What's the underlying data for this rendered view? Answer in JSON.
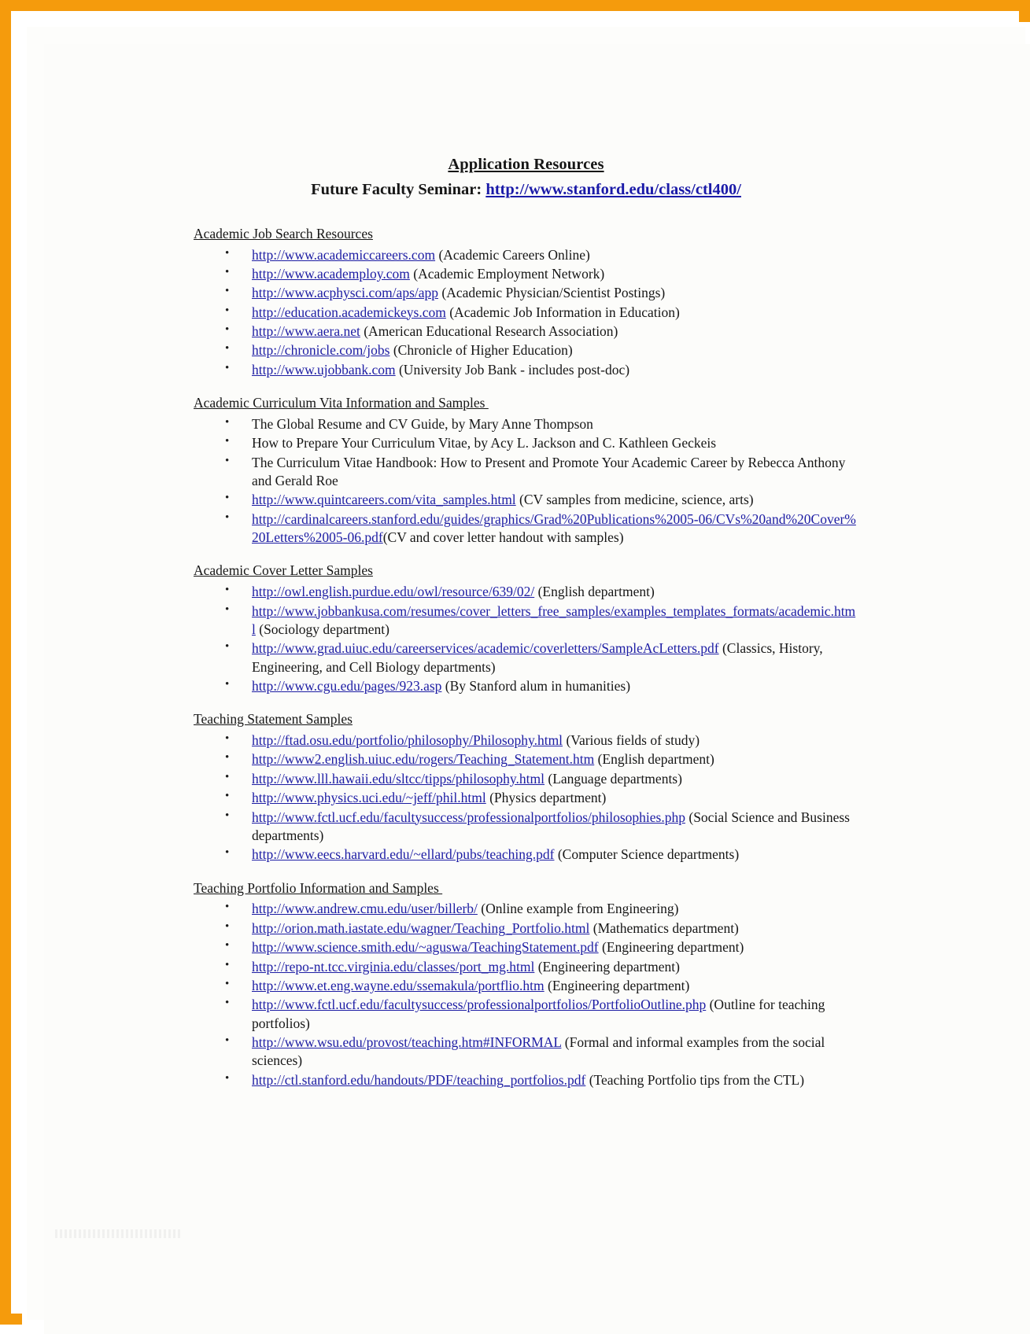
{
  "page": {
    "border_color": "#F59B0C",
    "link_color": "#1d1da4",
    "text_color": "#161616"
  },
  "header": {
    "title": "Application Resources",
    "subtitle_label": "Future Faculty Seminar:",
    "subtitle_url": "http://www.stanford.edu/class/ctl400/"
  },
  "sections": [
    {
      "heading": "Academic Job Search Resources",
      "items": [
        {
          "url": "http://www.academiccareers.com",
          "desc": " (Academic Careers Online)"
        },
        {
          "url": "http://www.academploy.com",
          "desc": " (Academic Employment Network)"
        },
        {
          "url": "http://www.acphysci.com/aps/app",
          "desc": " (Academic Physician/Scientist Postings)"
        },
        {
          "url": "http://education.academickeys.com",
          "desc": " (Academic Job Information in Education)"
        },
        {
          "url": "http://www.aera.net",
          "desc": " (American Educational Research Association)"
        },
        {
          "url": "http://chronicle.com/jobs",
          "desc": "  (Chronicle of Higher Education)"
        },
        {
          "url": "http://www.ujobbank.com",
          "desc": " (University Job Bank - includes post-doc)"
        }
      ]
    },
    {
      "heading": "Academic Curriculum Vita Information and Samples ",
      "items": [
        {
          "url": "",
          "desc": "The Global Resume and CV Guide, by Mary Anne Thompson"
        },
        {
          "url": "",
          "desc": "How to Prepare Your Curriculum Vitae, by Acy L. Jackson and C. Kathleen Geckeis"
        },
        {
          "url": "",
          "desc": "The Curriculum Vitae Handbook: How to Present and Promote Your Academic Career by Rebecca Anthony and Gerald Roe"
        },
        {
          "url": "http://www.quintcareers.com/vita_samples.html",
          "desc": " (CV samples from medicine, science, arts)"
        },
        {
          "url": "http://cardinalcareers.stanford.edu/guides/graphics/Grad%20Publications%2005-06/CVs%20and%20Cover%20Letters%2005-06.pdf",
          "desc": "(CV and cover letter handout with samples)"
        }
      ]
    },
    {
      "heading": "Academic Cover Letter Samples",
      "items": [
        {
          "url": "http://owl.english.purdue.edu/owl/resource/639/02/",
          "desc": " (English department)"
        },
        {
          "url": "http://www.jobbankusa.com/resumes/cover_letters_free_samples/examples_templates_formats/academic.html",
          "desc": " (Sociology department)",
          "justify": true
        },
        {
          "url": "http://www.grad.uiuc.edu/careerservices/academic/coverletters/SampleAcLetters.pdf",
          "desc": " (Classics, History, Engineering, and Cell Biology departments)"
        },
        {
          "url": "http://www.cgu.edu/pages/923.asp",
          "desc": " (By Stanford alum in humanities)"
        }
      ]
    },
    {
      "heading": "Teaching Statement Samples",
      "items": [
        {
          "url": "http://ftad.osu.edu/portfolio/philosophy/Philosophy.html",
          "desc": " (Various fields of study)"
        },
        {
          "url": "http://www2.english.uiuc.edu/rogers/Teaching_Statement.htm",
          "desc": " (English department)"
        },
        {
          "url": "http://www.lll.hawaii.edu/sltcc/tipps/philosophy.html",
          "desc": " (Language departments)"
        },
        {
          "url": "http://www.physics.uci.edu/~jeff/phil.html",
          "desc": " (Physics department)"
        },
        {
          "url": "http://www.fctl.ucf.edu/facultysuccess/professionalportfolios/philosophies.php",
          "desc": " (Social Science and Business departments)"
        },
        {
          "url": "http://www.eecs.harvard.edu/~ellard/pubs/teaching.pdf",
          "desc": " (Computer Science departments)"
        }
      ]
    },
    {
      "heading": "Teaching Portfolio Information and Samples ",
      "items": [
        {
          "url": "http://www.andrew.cmu.edu/user/billerb/",
          "desc": " (Online example from Engineering)"
        },
        {
          "url": "http://orion.math.iastate.edu/wagner/Teaching_Portfolio.html",
          "desc": " (Mathematics department)"
        },
        {
          "url": "http://www.science.smith.edu/~aguswa/TeachingStatement.pdf",
          "desc": " (Engineering department)"
        },
        {
          "url": "http://repo-nt.tcc.virginia.edu/classes/port_mg.html",
          "desc": " (Engineering department)"
        },
        {
          "url": "http://www.et.eng.wayne.edu/ssemakula/portflio.htm",
          "desc": " (Engineering department)"
        },
        {
          "url": "http://www.fctl.ucf.edu/facultysuccess/professionalportfolios/PortfolioOutline.php",
          "desc": " (Outline for teaching portfolios)"
        },
        {
          "url": "http://www.wsu.edu/provost/teaching.htm#INFORMAL",
          "desc": " (Formal and informal examples from the social sciences)"
        },
        {
          "url": "http://ctl.stanford.edu/handouts/PDF/teaching_portfolios.pdf",
          "desc": " (Teaching Portfolio tips from the CTL)"
        }
      ]
    }
  ]
}
